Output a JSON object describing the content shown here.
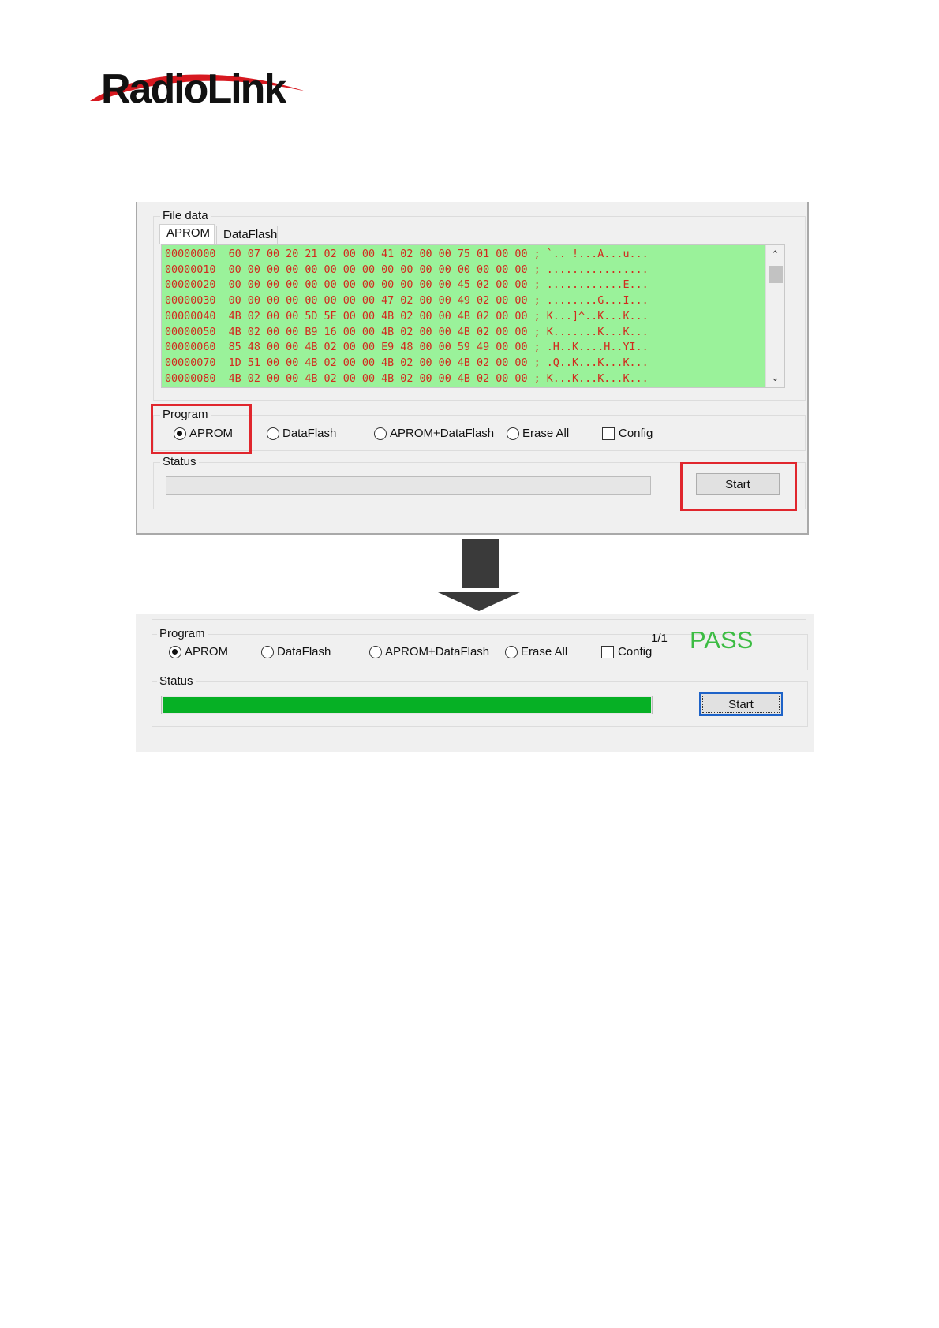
{
  "brand": {
    "name": "RadioLink"
  },
  "panel_top": {
    "file_group_title": "File data",
    "tabs": [
      {
        "label": "APROM"
      },
      {
        "label": "DataFlash"
      }
    ],
    "hex_lines": [
      "00000000  60 07 00 20 21 02 00 00 41 02 00 00 75 01 00 00 ; `.. !...A...u...",
      "00000010  00 00 00 00 00 00 00 00 00 00 00 00 00 00 00 00 ; ................",
      "00000020  00 00 00 00 00 00 00 00 00 00 00 00 45 02 00 00 ; ............E...",
      "00000030  00 00 00 00 00 00 00 00 47 02 00 00 49 02 00 00 ; ........G...I...",
      "00000040  4B 02 00 00 5D 5E 00 00 4B 02 00 00 4B 02 00 00 ; K...]^..K...K...",
      "00000050  4B 02 00 00 B9 16 00 00 4B 02 00 00 4B 02 00 00 ; K.......K...K...",
      "00000060  85 48 00 00 4B 02 00 00 E9 48 00 00 59 49 00 00 ; .H..K....H..YI..",
      "00000070  1D 51 00 00 4B 02 00 00 4B 02 00 00 4B 02 00 00 ; .Q..K...K...K...",
      "00000080  4B 02 00 00 4B 02 00 00 4B 02 00 00 4B 02 00 00 ; K...K...K...K..."
    ],
    "program_title": "Program",
    "options": [
      {
        "label": "APROM",
        "selected": true
      },
      {
        "label": "DataFlash",
        "selected": false
      },
      {
        "label": "APROM+DataFlash",
        "selected": false
      },
      {
        "label": "Erase All",
        "selected": false
      }
    ],
    "config_label": "Config",
    "status_title": "Status",
    "progress": 0,
    "start_label": "Start",
    "highlight_color": "#e0262d"
  },
  "panel_bottom": {
    "program_title": "Program",
    "options": [
      {
        "label": "APROM",
        "selected": true
      },
      {
        "label": "DataFlash",
        "selected": false
      },
      {
        "label": "APROM+DataFlash",
        "selected": false
      },
      {
        "label": "Erase All",
        "selected": false
      }
    ],
    "config_label": "Config",
    "count": "1/1",
    "result": "PASS",
    "result_color": "#3cbc43",
    "status_title": "Status",
    "progress": 1.0,
    "progress_color": "#06b025",
    "start_label": "Start"
  }
}
